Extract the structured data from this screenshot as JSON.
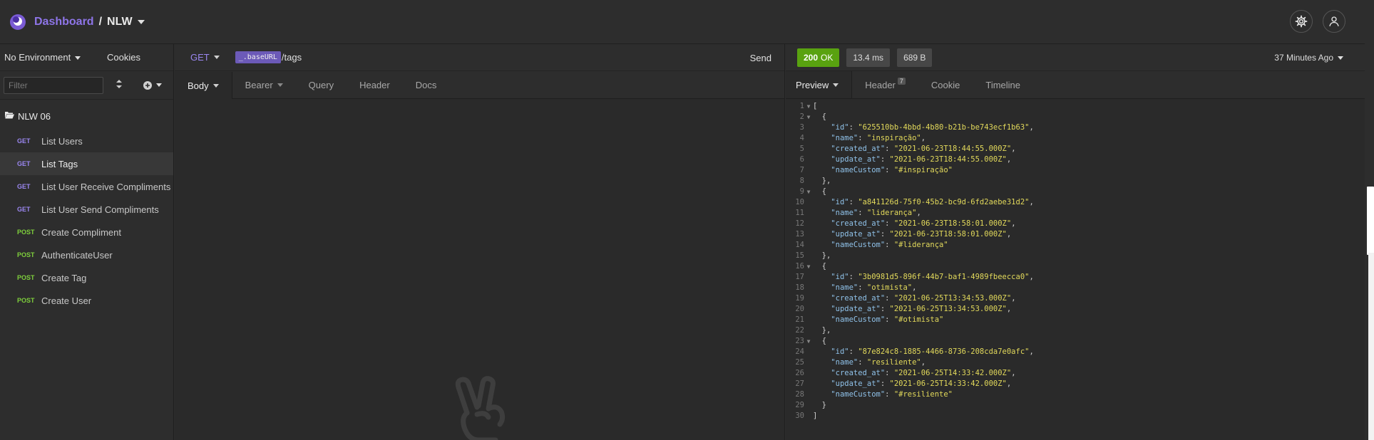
{
  "header": {
    "breadcrumb_root": "Dashboard",
    "separator": "/",
    "project": "NLW"
  },
  "sidebar": {
    "environment": "No Environment",
    "cookies": "Cookies",
    "filter_placeholder": "Filter",
    "folder": "NLW 06",
    "requests": [
      {
        "method": "GET",
        "name": "List Users",
        "active": false
      },
      {
        "method": "GET",
        "name": "List Tags",
        "active": true
      },
      {
        "method": "GET",
        "name": "List User Receive Compliments",
        "active": false
      },
      {
        "method": "GET",
        "name": "List User Send Compliments",
        "active": false
      },
      {
        "method": "POST",
        "name": "Create Compliment",
        "active": false
      },
      {
        "method": "POST",
        "name": "AuthenticateUser",
        "active": false
      },
      {
        "method": "POST",
        "name": "Create Tag",
        "active": false
      },
      {
        "method": "POST",
        "name": "Create User",
        "active": false
      }
    ]
  },
  "request": {
    "method": "GET",
    "variable": "_.baseURL",
    "path": "/tags",
    "send": "Send",
    "tabs": [
      "Body",
      "Bearer",
      "Query",
      "Header",
      "Docs"
    ]
  },
  "response": {
    "status_code": "200",
    "status_text": "OK",
    "time": "13.4 ms",
    "size": "689 B",
    "ago": "37 Minutes Ago",
    "tabs": {
      "preview": "Preview",
      "header": "Header",
      "header_count": "7",
      "cookie": "Cookie",
      "timeline": "Timeline"
    },
    "body_lines": [
      "[",
      "  {",
      "    \"id\": \"625510bb-4bbd-4b80-b21b-be743ecf1b63\",",
      "    \"name\": \"inspiração\",",
      "    \"created_at\": \"2021-06-23T18:44:55.000Z\",",
      "    \"update_at\": \"2021-06-23T18:44:55.000Z\",",
      "    \"nameCustom\": \"#inspiração\"",
      "  },",
      "  {",
      "    \"id\": \"a841126d-75f0-45b2-bc9d-6fd2aebe31d2\",",
      "    \"name\": \"liderança\",",
      "    \"created_at\": \"2021-06-23T18:58:01.000Z\",",
      "    \"update_at\": \"2021-06-23T18:58:01.000Z\",",
      "    \"nameCustom\": \"#liderança\"",
      "  },",
      "  {",
      "    \"id\": \"3b0981d5-896f-44b7-baf1-4989fbeecca0\",",
      "    \"name\": \"otimista\",",
      "    \"created_at\": \"2021-06-25T13:34:53.000Z\",",
      "    \"update_at\": \"2021-06-25T13:34:53.000Z\",",
      "    \"nameCustom\": \"#otimista\"",
      "  },",
      "  {",
      "    \"id\": \"87e824c8-1885-4466-8736-208cda7e0afc\",",
      "    \"name\": \"resiliente\",",
      "    \"created_at\": \"2021-06-25T14:33:42.000Z\",",
      "    \"update_at\": \"2021-06-25T14:33:42.000Z\",",
      "    \"nameCustom\": \"#resiliente\"",
      "  }",
      "]"
    ],
    "foldable_lines": [
      1,
      2,
      9,
      16,
      23
    ]
  },
  "colors": {
    "accent": "#8e75e8",
    "get": "#9a86f0",
    "post": "#7ecf3c",
    "ok": "#59a210",
    "json_key": "#8fc1e8",
    "json_string": "#e2d95b"
  }
}
